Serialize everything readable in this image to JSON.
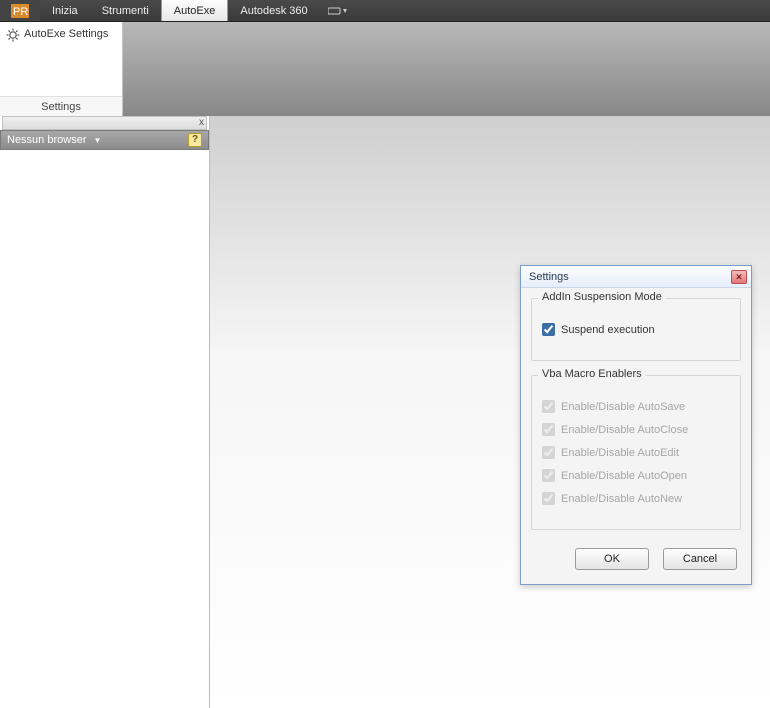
{
  "menubar": {
    "items": [
      "Inizia",
      "Strumenti",
      "AutoExe",
      "Autodesk 360"
    ],
    "active_index": 2
  },
  "ribbon": {
    "button_label": "AutoExe Settings",
    "panel_title": "Settings"
  },
  "left_panel": {
    "title": "Nessun browser",
    "close_glyph": "x",
    "help_glyph": "?"
  },
  "dialog": {
    "title": "Settings",
    "group1": {
      "legend": "AddIn Suspension Mode",
      "suspend_label": "Suspend execution",
      "suspend_checked": true
    },
    "group2": {
      "legend": "Vba Macro Enablers",
      "items": [
        {
          "label": "Enable/Disable AutoSave",
          "checked": true,
          "disabled": true
        },
        {
          "label": "Enable/Disable AutoClose",
          "checked": true,
          "disabled": true
        },
        {
          "label": "Enable/Disable AutoEdit",
          "checked": true,
          "disabled": true
        },
        {
          "label": "Enable/Disable AutoOpen",
          "checked": true,
          "disabled": true
        },
        {
          "label": "Enable/Disable AutoNew",
          "checked": true,
          "disabled": true
        }
      ]
    },
    "ok_label": "OK",
    "cancel_label": "Cancel"
  }
}
